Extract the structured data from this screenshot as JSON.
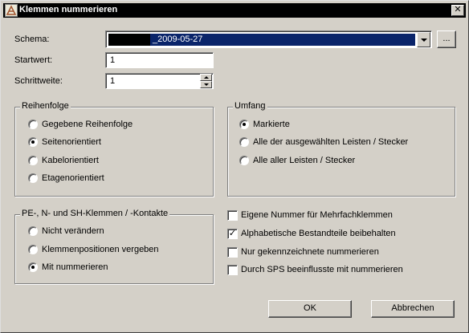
{
  "window": {
    "title": "Klemmen nummerieren",
    "close_glyph": "✕"
  },
  "schema": {
    "label": "Schema:",
    "value": "_2009-05-27",
    "browse_label": "..."
  },
  "startwert": {
    "label": "Startwert:",
    "value": "1"
  },
  "schrittweite": {
    "label": "Schrittweite:",
    "value": "1"
  },
  "reihenfolge": {
    "title": "Reihenfolge",
    "options": [
      {
        "label": "Gegebene Reihenfolge",
        "selected": false
      },
      {
        "label": "Seitenorientiert",
        "selected": true
      },
      {
        "label": "Kabelorientiert",
        "selected": false
      },
      {
        "label": "Etagenorientiert",
        "selected": false
      }
    ]
  },
  "umfang": {
    "title": "Umfang",
    "options": [
      {
        "label": "Markierte",
        "selected": true
      },
      {
        "label": "Alle der ausgewählten Leisten / Stecker",
        "selected": false
      },
      {
        "label": "Alle aller Leisten / Stecker",
        "selected": false
      }
    ]
  },
  "pe_klemmen": {
    "title": "PE-, N- und SH-Klemmen / -Kontakte",
    "options": [
      {
        "label": "Nicht verändern",
        "selected": false
      },
      {
        "label": "Klemmenpositionen vergeben",
        "selected": false
      },
      {
        "label": "Mit nummerieren",
        "selected": true
      }
    ]
  },
  "checkboxes": [
    {
      "label": "Eigene Nummer für Mehrfachklemmen",
      "checked": false
    },
    {
      "label": "Alphabetische Bestandteile beibehalten",
      "checked": true
    },
    {
      "label": "Nur gekennzeichnete nummerieren",
      "checked": false
    },
    {
      "label": "Durch SPS beeinflusste mit nummerieren",
      "checked": false
    }
  ],
  "buttons": {
    "ok": "OK",
    "cancel": "Abbrechen"
  },
  "icons": {
    "app": "eplan-app-icon",
    "close": "close-icon",
    "dropdown": "chevron-down-icon",
    "spin_up": "spin-up-icon",
    "spin_down": "spin-down-icon"
  }
}
